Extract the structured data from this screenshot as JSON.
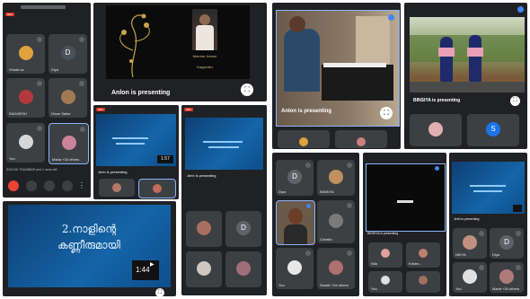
{
  "panel1": {
    "tiles": [
      {
        "label": "Vrinda cs",
        "kind": "photo"
      },
      {
        "label": "Diya",
        "kind": "letter",
        "letter": "D"
      },
      {
        "label": "RAGHESH",
        "kind": "photo"
      },
      {
        "label": "Dixon Sailor",
        "kind": "photo"
      },
      {
        "label": "You",
        "kind": "photo"
      },
      {
        "label": "Maria +34 others",
        "kind": "photo"
      }
    ],
    "bottom_text": "SOUVIK TOUNIBAR and 1 more left",
    "cam_icon": "camera-icon",
    "hangup_icon": "hangup-icon"
  },
  "panel2": {
    "poster_name": "Merrine Jomon",
    "poster_sub": "Kayyunku",
    "presenting": "Anlon is presenting",
    "fullscreen_icon": "fullscreen-icon"
  },
  "panel3": {
    "presenting": "Jerin is presenting",
    "timer": "1:57"
  },
  "panel4": {
    "presenting": "Jerin is presenting"
  },
  "panel5": {
    "title_line1": "2.നാളിന്റെ",
    "title_line2": "കണ്ണീരുമായി",
    "timer": "1:44"
  },
  "panel6": {
    "presenting": "Anlon is presenting"
  },
  "panel7": {
    "presenting": "BINSIYA is presenting"
  },
  "panel8": {
    "tiles": [
      {
        "label": "Diya",
        "kind": "letter",
        "letter": "D"
      },
      {
        "label": "BINSIYA",
        "kind": "photo"
      },
      {
        "label": "",
        "kind": "photo"
      },
      {
        "label": "Christin",
        "kind": "photo"
      },
      {
        "label": "You",
        "kind": "photo"
      },
      {
        "label": "Sarath +34 others",
        "kind": "photo"
      }
    ]
  },
  "panel9": {
    "presenting": "BINSIYA is presenting",
    "tiles": [
      {
        "label": "Nila"
      },
      {
        "label": "Krishn..."
      },
      {
        "label": "You"
      }
    ]
  },
  "panel10": {
    "presenting": "Jerin is presenting",
    "tiles": [
      {
        "label": "NIKYA",
        "kind": "photo"
      },
      {
        "label": "Diya",
        "kind": "letter",
        "letter": "D"
      },
      {
        "label": "You",
        "kind": "photo"
      },
      {
        "label": "Maria +34 others",
        "kind": "photo"
      }
    ]
  },
  "strip_tiles": {
    "s_letter": "S",
    "d_letter": "D"
  },
  "colors": {
    "meet_bg": "#202124",
    "tile_bg": "#3c4043",
    "accent_blue": "#4285f4",
    "hangup_red": "#ea4335",
    "slide_blue": "#1565a8"
  }
}
